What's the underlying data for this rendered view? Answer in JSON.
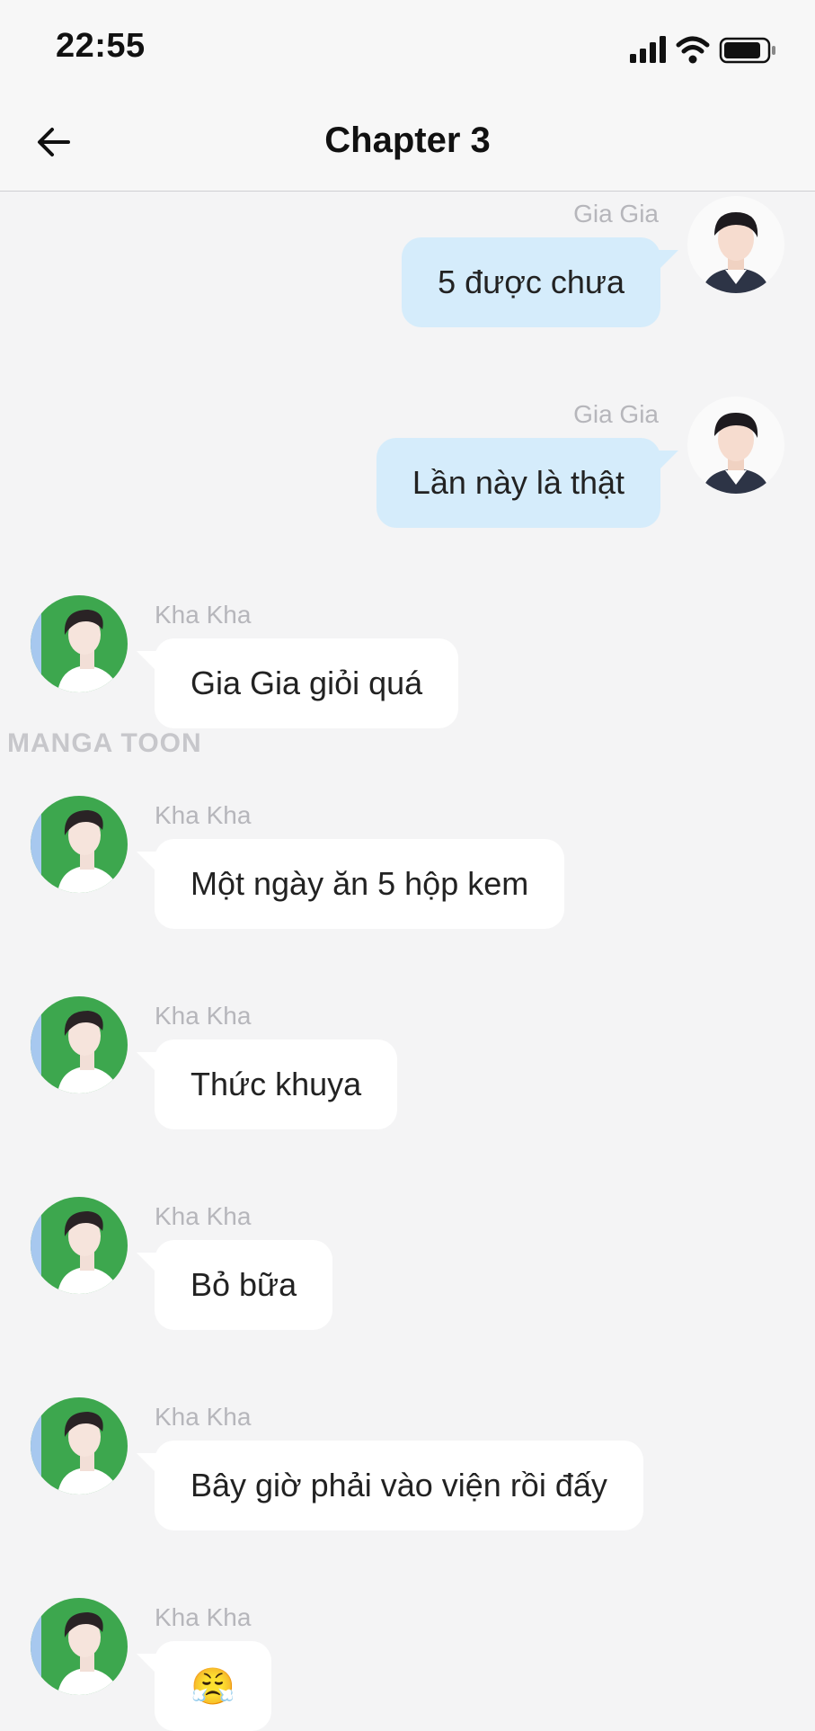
{
  "status_bar": {
    "time": "22:55"
  },
  "header": {
    "title": "Chapter 3",
    "back_icon": "arrow-left-icon"
  },
  "watermark": "MANGA TOON",
  "messages": [
    {
      "side": "right",
      "sender": "Gia Gia",
      "text": "5 được chưa"
    },
    {
      "side": "right",
      "sender": "Gia Gia",
      "text": "Lần này là thật"
    },
    {
      "side": "left",
      "sender": "Kha Kha",
      "text": "Gia Gia giỏi quá"
    },
    {
      "side": "left",
      "sender": "Kha Kha",
      "text": "Một ngày ăn 5 hộp kem"
    },
    {
      "side": "left",
      "sender": "Kha Kha",
      "text": "Thức khuya"
    },
    {
      "side": "left",
      "sender": "Kha Kha",
      "text": "Bỏ bữa"
    },
    {
      "side": "left",
      "sender": "Kha Kha",
      "text": "Bây giờ phải vào viện rồi đấy"
    },
    {
      "side": "left",
      "sender": "Kha Kha",
      "text": "😤"
    }
  ],
  "colors": {
    "right_bubble": "#d5ecfb",
    "left_bubble": "#ffffff",
    "background": "#f4f4f5",
    "name_text": "#b6b6bb"
  }
}
